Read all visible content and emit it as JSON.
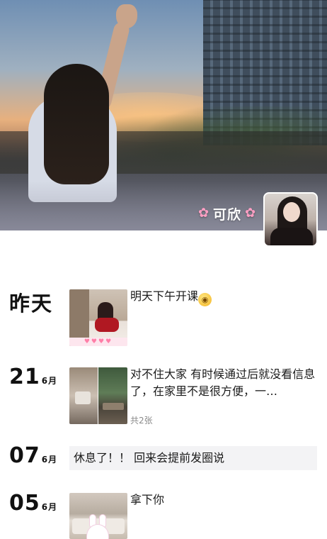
{
  "profile": {
    "nickname": "可欣",
    "flower_icon": "cherry-blossom-icon",
    "flower_glyph": "✿"
  },
  "timeline": [
    {
      "date_word": "昨天",
      "text": "明天下午开课",
      "emoji": "flushed-face-emoji",
      "thumb_strip": "♥♥♥♥"
    },
    {
      "day": "21",
      "month": "6月",
      "text": "对不住大家 有时候通过后就没看信息了，在家里不是很方便，一…",
      "image_count": "共2张"
    },
    {
      "day": "07",
      "month": "6月",
      "text": "休息了！！ 回来会提前发圈说"
    },
    {
      "day": "05",
      "month": "6月",
      "text": "拿下你"
    }
  ],
  "colors": {
    "background": "#ffffff",
    "text_only_bubble": "#f3f3f5",
    "nickname": "#ffffff"
  }
}
